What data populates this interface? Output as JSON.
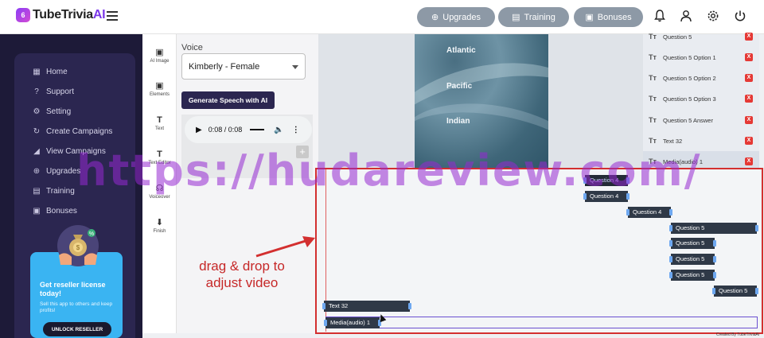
{
  "app": {
    "logo_main": "TubeTrivia",
    "logo_ai": "AI",
    "logo_badge": "6"
  },
  "header": {
    "buttons": [
      {
        "label": "Upgrades",
        "icon": "upload-circle-icon"
      },
      {
        "label": "Training",
        "icon": "graduation-cap-icon"
      },
      {
        "label": "Bonuses",
        "icon": "gift-icon"
      }
    ],
    "icons": [
      "bell-icon",
      "user-icon",
      "gear-icon",
      "power-icon"
    ]
  },
  "sidebar": {
    "items": [
      {
        "label": "Home",
        "icon": "grid-icon"
      },
      {
        "label": "Support",
        "icon": "help-circle-icon"
      },
      {
        "label": "Setting",
        "icon": "gear-icon"
      },
      {
        "label": "Create Campaigns",
        "icon": "refresh-icon"
      },
      {
        "label": "View Campaigns",
        "icon": "megaphone-icon"
      },
      {
        "label": "Upgrades",
        "icon": "upload-circle-icon"
      },
      {
        "label": "Training",
        "icon": "graduation-cap-icon"
      },
      {
        "label": "Bonuses",
        "icon": "gift-icon"
      }
    ],
    "promo": {
      "title": "Get reseller license today!",
      "subtitle": "Sell this app to others and keep profits!",
      "button": "UNLOCK RESELLER"
    }
  },
  "tools": [
    {
      "label": "AI Image",
      "icon": "image-icon"
    },
    {
      "label": "Elements",
      "icon": "image-icon"
    },
    {
      "label": "Text",
      "icon": "text-t-icon"
    },
    {
      "label": "Text Editor",
      "icon": "text-t-icon"
    },
    {
      "label": "Voiceover",
      "icon": "voiceover-icon"
    },
    {
      "label": "Finish",
      "icon": "download-icon"
    }
  ],
  "voice": {
    "label": "Voice",
    "selected": "Kimberly - Female",
    "generate_button": "Generate Speech with AI",
    "audio_time": "0:08 / 0:08",
    "add_button": "+"
  },
  "preview": {
    "options": [
      "Atlantic",
      "Pacific",
      "Indian"
    ]
  },
  "layers": [
    {
      "name": "Question 5"
    },
    {
      "name": "Question 5 Option 1"
    },
    {
      "name": "Question 5 Option 2"
    },
    {
      "name": "Question 5 Option 3"
    },
    {
      "name": "Question 5 Answer"
    },
    {
      "name": "Text 32"
    },
    {
      "name": "Media(audio) 1"
    }
  ],
  "layer_delete_label": "X",
  "layer_type_icon": "Tт",
  "timeline": {
    "clips": [
      {
        "label": "Question 4"
      },
      {
        "label": "Question 4"
      },
      {
        "label": "Question 4"
      },
      {
        "label": "Question 5"
      },
      {
        "label": "Question 5"
      },
      {
        "label": "Question 5"
      },
      {
        "label": "Question 5"
      },
      {
        "label": "Question 5"
      },
      {
        "label": "Text 32"
      },
      {
        "label": "Media(audio) 1"
      }
    ]
  },
  "annotation": "drag & drop to adjust video",
  "watermark": "https://hudareview.com/",
  "credit": "Created By TubeTriviaAi",
  "colors": {
    "accent": "#7b38e8",
    "sidebar_bg": "#2b2650",
    "header_button": "#8d99a6",
    "annotation_red": "#d32f2f",
    "delete_red": "#e53935",
    "promo_blue": "#3ab4f2",
    "watermark": "#9628d2"
  }
}
